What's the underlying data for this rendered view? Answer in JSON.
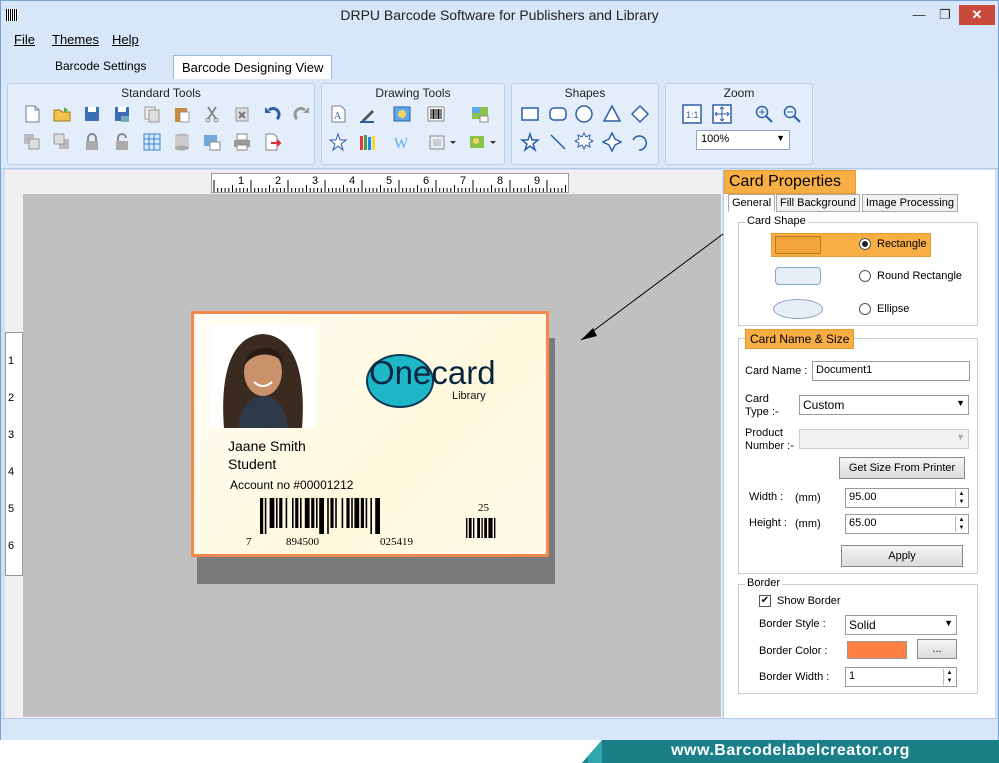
{
  "window": {
    "title": "DRPU Barcode Software for Publishers and Library",
    "minimize": "—",
    "maximize": "❐",
    "close": "✕"
  },
  "menu": {
    "file": "File",
    "themes": "Themes",
    "help": "Help"
  },
  "tabs": {
    "barcode_settings": "Barcode Settings",
    "barcode_designing_view": "Barcode Designing View"
  },
  "ribbon": {
    "standard_tools": "Standard Tools",
    "drawing_tools": "Drawing Tools",
    "shapes": "Shapes",
    "zoom": "Zoom",
    "zoom_value": "100%"
  },
  "rulers": {
    "horizontal": [
      "1",
      "2",
      "3",
      "4",
      "5",
      "6",
      "7",
      "8",
      "9"
    ],
    "vertical": [
      "1",
      "2",
      "3",
      "4",
      "5",
      "6"
    ]
  },
  "card": {
    "logo_main": "Onecard",
    "logo_sub": "Library",
    "name": "Jaane Smith",
    "role": "Student",
    "account": "Account no  #00001212",
    "barcode_left_digit": "7",
    "barcode_mid1": "894500",
    "barcode_mid2": "025419",
    "barcode_addon": "25",
    "border_color": "#f2884b"
  },
  "properties": {
    "header": "Card Properties",
    "tabs": [
      "General",
      "Fill Background",
      "Image Processing"
    ],
    "card_shape": {
      "legend": "Card Shape",
      "options": [
        "Rectangle",
        "Round Rectangle",
        "Ellipse"
      ],
      "selected": "Rectangle"
    },
    "name_size": {
      "legend": "Card  Name & Size",
      "card_name_label": "Card Name :",
      "card_name_value": "Document1",
      "card_type_label": "Card\nType :-",
      "card_type_line1": "Card",
      "card_type_line2": "Type :-",
      "card_type_value": "Custom",
      "product_number_line1": "Product",
      "product_number_line2": "Number :-",
      "get_size_button": "Get Size From Printer",
      "width_label": "Width :",
      "height_label": "Height :",
      "unit": "(mm)",
      "width_value": "95.00",
      "height_value": "65.00",
      "apply_button": "Apply"
    },
    "border": {
      "legend": "Border",
      "show_border_label": "Show Border",
      "show_border_checked": true,
      "style_label": "Border Style :",
      "style_value": "Solid",
      "color_label": "Border Color :",
      "color_value": "#ff8040",
      "color_button": "...",
      "width_label": "Border Width :",
      "width_value": "1"
    }
  },
  "footer": {
    "website": "www.Barcodelabelcreator.org"
  }
}
